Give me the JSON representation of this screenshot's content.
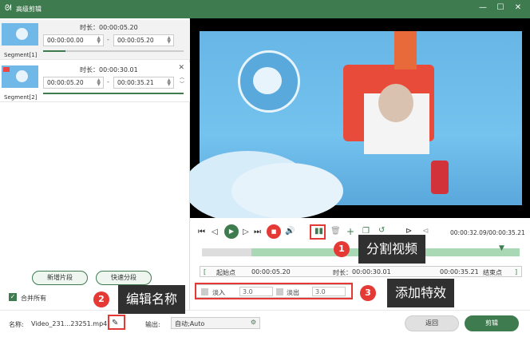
{
  "window": {
    "title": "高级剪辑",
    "logo": "rabbit-logo-icon"
  },
  "segments": [
    {
      "label": "Segment[1]",
      "duration_label": "时长：",
      "duration": "00:00:05.20",
      "start": "00:00:00.00",
      "end": "00:00:05.20",
      "progress": 0.16
    },
    {
      "label": "Segment[2]",
      "duration_label": "时长：",
      "duration": "00:00:30.01",
      "start": "00:00:05.20",
      "end": "00:00:35.21",
      "progress": 1.0
    }
  ],
  "left_actions": {
    "add_segment": "新增片段",
    "quick_split": "快速分段",
    "merge_all": "合并所有"
  },
  "player": {
    "current_time": "00:00:32.09/00:00:35.21"
  },
  "marks": {
    "start_label": "起始点",
    "start_time": "00:00:05.20",
    "duration_label": "时长：",
    "duration": "00:00:30.01",
    "end_time": "00:00:35.21",
    "end_label": "结束点"
  },
  "effects": {
    "fade_in_label": "淡入",
    "fade_in_value": "3.0",
    "fade_out_label": "淡出",
    "fade_out_value": "3.0"
  },
  "footer": {
    "name_label": "名称:",
    "filename": "Video_231...23251.mp4",
    "output_label": "输出:",
    "output_value": "自动;Auto",
    "back": "返回",
    "cut": "剪辑"
  },
  "callouts": [
    {
      "num": "1",
      "text": "分割视频"
    },
    {
      "num": "2",
      "text": "编辑名称"
    },
    {
      "num": "3",
      "text": "添加特效"
    }
  ],
  "colors": {
    "accent": "#3e7b4e",
    "callout_red": "#e53935"
  }
}
